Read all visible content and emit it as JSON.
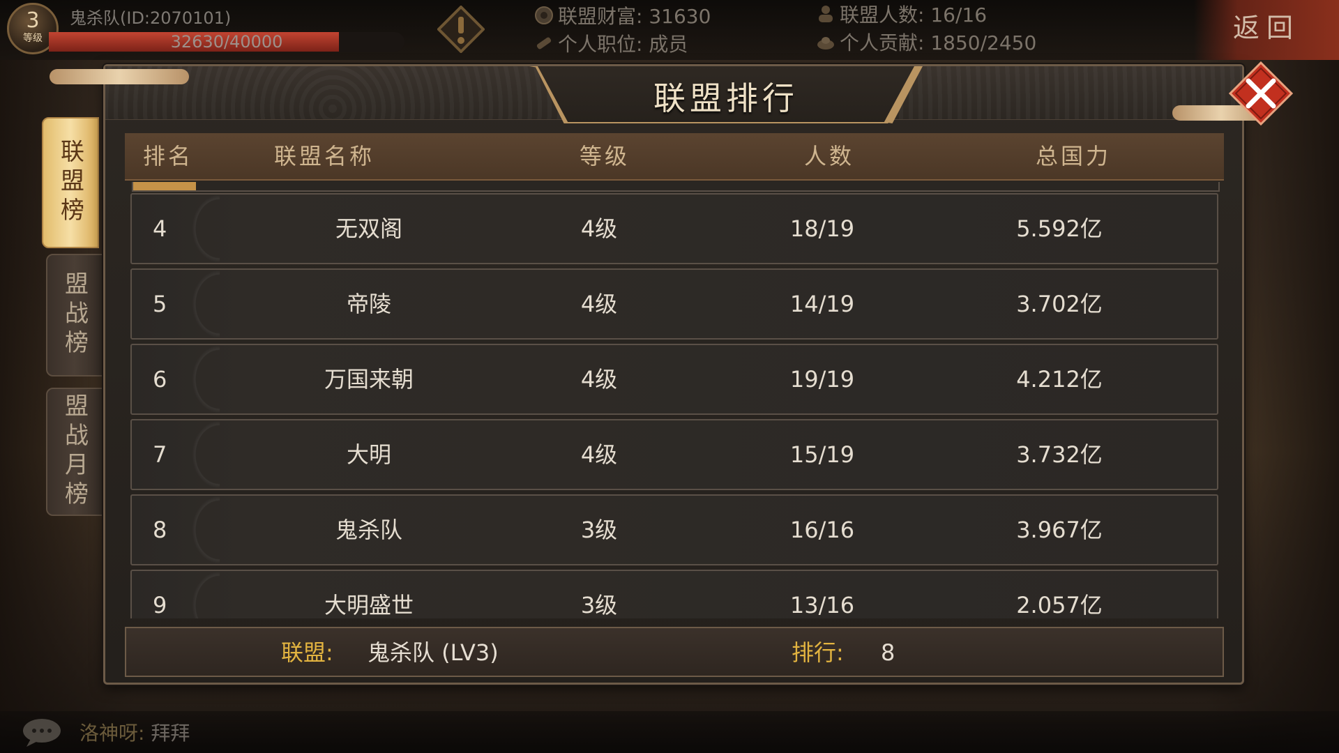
{
  "topbar": {
    "level_num": "3",
    "level_label": "等级",
    "player_name": "鬼杀队(ID:2070101)",
    "exp_text": "32630/40000",
    "exp_progress": 0.8158,
    "alliance_wealth": "联盟财富: 31630",
    "member_count": "联盟人数: 16/16",
    "position": "个人职位: 成员",
    "contribution": "个人贡献: 1850/2450",
    "back_label": "返回"
  },
  "sidebar": {
    "tabs": [
      {
        "label": "联盟榜",
        "active": true
      },
      {
        "label": "盟战榜",
        "active": false
      },
      {
        "label": "盟战月榜",
        "active": false
      }
    ]
  },
  "panel": {
    "title": "联盟排行",
    "columns": [
      "排名",
      "联盟名称",
      "等级",
      "人数",
      "总国力"
    ],
    "rows": [
      {
        "rank": "4",
        "name": "无双阁",
        "level": "4级",
        "members": "18/19",
        "power": "5.592亿"
      },
      {
        "rank": "5",
        "name": "帝陵",
        "level": "4级",
        "members": "14/19",
        "power": "3.702亿"
      },
      {
        "rank": "6",
        "name": "万国来朝",
        "level": "4级",
        "members": "19/19",
        "power": "4.212亿"
      },
      {
        "rank": "7",
        "name": "大明",
        "level": "4级",
        "members": "15/19",
        "power": "3.732亿"
      },
      {
        "rank": "8",
        "name": "鬼杀队",
        "level": "3级",
        "members": "16/16",
        "power": "3.967亿"
      },
      {
        "rank": "9",
        "name": "大明盛世",
        "level": "3级",
        "members": "13/16",
        "power": "2.057亿"
      }
    ],
    "footer": {
      "alliance_label": "联盟:",
      "alliance_value": "鬼杀队 (LV3)",
      "rank_label": "排行:",
      "rank_value": "8"
    }
  },
  "chat": {
    "speaker": "洛神呀:",
    "message": "拜拜"
  },
  "colors": {
    "accent_gold": "#e3b440",
    "close_red": "#c2301f",
    "exp_red": "#c24431",
    "tab_active": "#f6dfa6"
  }
}
